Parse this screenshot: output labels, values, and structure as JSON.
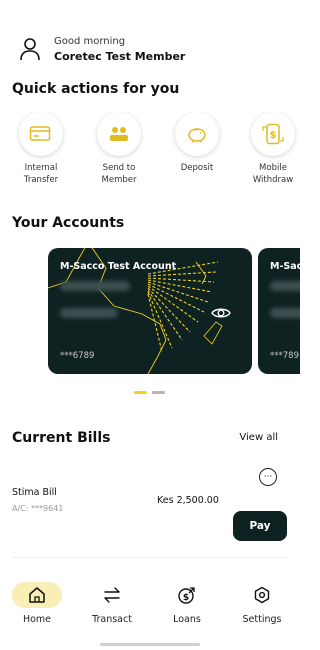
{
  "colors": {
    "accent": "#f2d024",
    "dark": "#0f2222",
    "active_bg": "#f9eeb5"
  },
  "header": {
    "greeting": "Good morning",
    "member_name": "Coretec Test Member",
    "avatar_icon": "user-icon"
  },
  "quick_actions": {
    "title": "Quick actions for you",
    "items": [
      {
        "label": "Internal\nTransfer",
        "icon": "card-transfer-icon"
      },
      {
        "label": "Send to\nMember",
        "icon": "members-icon"
      },
      {
        "label": "Deposit",
        "icon": "piggy-bank-icon"
      },
      {
        "label": "Mobile\nWithdraw",
        "icon": "mobile-money-icon"
      }
    ]
  },
  "accounts": {
    "title": "Your Accounts",
    "cards": [
      {
        "name": "M-Sacco Test Account",
        "number": "***6789"
      },
      {
        "name": "M-Sac",
        "number": "***789"
      }
    ],
    "page_indicator": {
      "active_index": 0,
      "count": 2
    }
  },
  "bills": {
    "title": "Current Bills",
    "view_all": "View all",
    "items": [
      {
        "name": "Stima Bill",
        "account": "A/C: ***9641",
        "amount": "Kes 2,500.00",
        "pay_label": "Pay",
        "more": "···"
      }
    ]
  },
  "nav": {
    "items": [
      {
        "label": "Home",
        "icon": "home-icon",
        "active": true
      },
      {
        "label": "Transact",
        "icon": "transfer-arrows-icon",
        "active": false
      },
      {
        "label": "Loans",
        "icon": "loan-coin-icon",
        "active": false
      },
      {
        "label": "Settings",
        "icon": "settings-hexagon-icon",
        "active": false
      }
    ]
  }
}
